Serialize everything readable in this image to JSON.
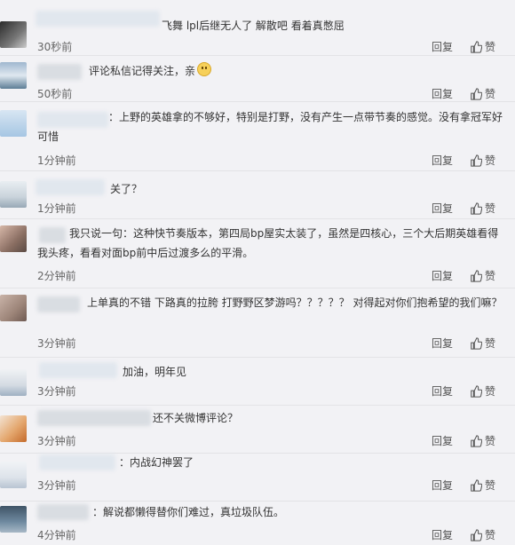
{
  "actions": {
    "reply": "回复",
    "like": "赞"
  },
  "comments": [
    {
      "sep": "：",
      "text": "飞舞 lpl后继无人了 解散吧 看着真憋屈",
      "time": "30秒前"
    },
    {
      "sep": "：",
      "text": "评论私信记得关注，亲",
      "time": "50秒前"
    },
    {
      "sep": "：",
      "text": "上野的英雄拿的不够好，特别是打野，没有产生一点带节奏的感觉。没有拿冠军好可惜",
      "time": "1分钟前"
    },
    {
      "sep": "：",
      "text": "关了？",
      "time": "1分钟前"
    },
    {
      "sep": "：",
      "text": "我只说一句：这种快节奏版本，第四局bp屋实太装了，虽然是四核心，三个大后期英雄看得我头疼，看看对面bp前中后过渡多么的平滑。",
      "time": "2分钟前"
    },
    {
      "sep": "：",
      "text": "上单真的不错 下路真的拉胯 打野野区梦游吗？？？？？ 对得起对你们抱希望的我们嘛？",
      "time": "3分钟前"
    },
    {
      "sep": "：",
      "text": "加油，明年见",
      "time": "3分钟前"
    },
    {
      "sep": "：",
      "text": "还不关微博评论？",
      "time": "3分钟前"
    },
    {
      "sep": "：",
      "text": "内战幻神罢了",
      "time": "3分钟前"
    },
    {
      "sep": "：",
      "text": "解说都懒得替你们难过，真垃圾队伍。",
      "time": "4分钟前"
    }
  ]
}
